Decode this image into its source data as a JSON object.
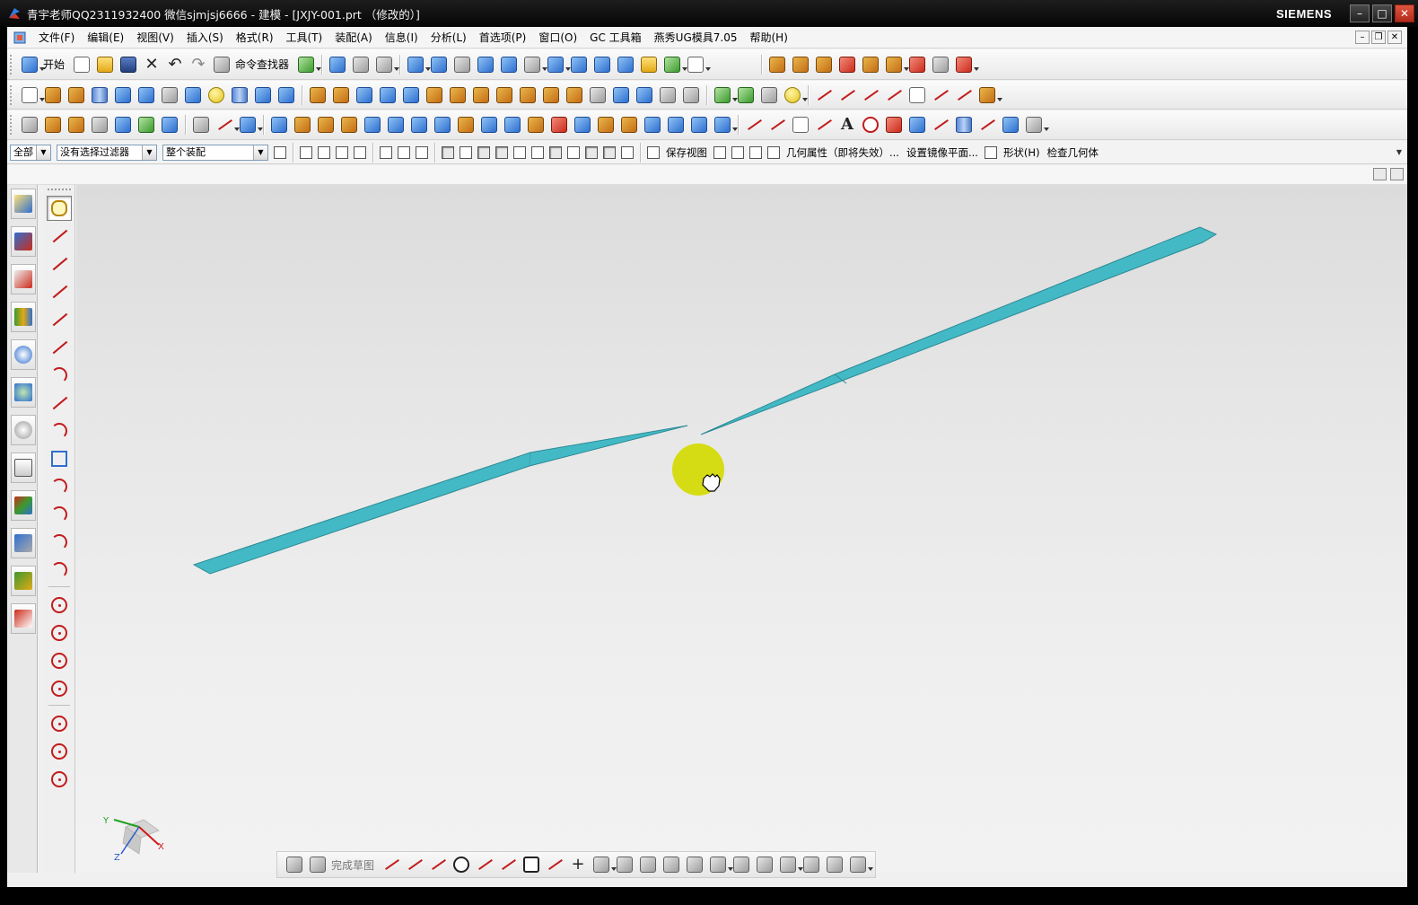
{
  "window": {
    "title": "青宇老师QQ2311932400 微信sjmjsj6666 - 建模 - [JXJY-001.prt （修改的）]",
    "brand": "SIEMENS",
    "minimize": "–",
    "maximize": "□",
    "close": "✕"
  },
  "menubar": {
    "items": [
      "文件(F)",
      "编辑(E)",
      "视图(V)",
      "插入(S)",
      "格式(R)",
      "工具(T)",
      "装配(A)",
      "信息(I)",
      "分析(L)",
      "首选项(P)",
      "窗口(O)",
      "GC 工具箱",
      "燕秀UG模具7.05",
      "帮助(H)"
    ]
  },
  "toolbar_standard": {
    "start_label": "开始",
    "command_finder_label": "命令查找器"
  },
  "filterbar": {
    "type_filter": "全部",
    "selection_filter": "没有选择过滤器",
    "scope": "整个装配",
    "save_view": "保存视图",
    "geometry_property": "几何属性（即将失效）...",
    "mirror_plane": "设置镜像平面...",
    "shape": "形状(H)",
    "check_geometry": "检查几何体"
  },
  "bottom_sketch": {
    "finish_sketch": "完成草图"
  },
  "colors": {
    "body_fill": "#44b9c6",
    "body_edge": "#2a8a94",
    "cursor_highlight": "#d6dc14"
  },
  "triad": {
    "x": "X",
    "y": "Y",
    "z": "Z"
  }
}
